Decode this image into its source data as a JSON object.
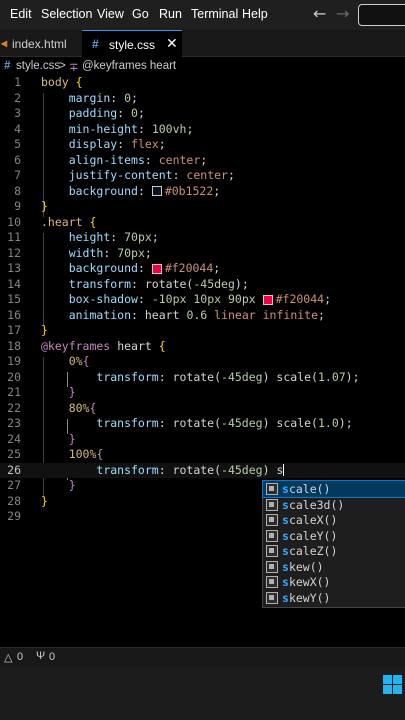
{
  "menubar": {
    "items": [
      "Edit",
      "Selection",
      "View",
      "Go",
      "Run",
      "Terminal",
      "Help"
    ],
    "back_glyph": "←",
    "forward_glyph": "→"
  },
  "tabs": [
    {
      "label": "index.html",
      "icon": "html-file-icon"
    },
    {
      "label": "style.css",
      "icon": "css-file-icon",
      "icon_glyph": "#",
      "close": "✕"
    }
  ],
  "breadcrumb": {
    "file": "style.css",
    "separator": ">",
    "symbol": "@keyframes heart",
    "file_glyph": "#"
  },
  "code_lines": [
    "body {",
    "    margin: 0;",
    "    padding: 0;",
    "    min-height: 100vh;",
    "    display: flex;",
    "    align-items: center;",
    "    justify-content: center;",
    "    background: #0b1522;",
    "}",
    ".heart {",
    "    height: 70px;",
    "    width: 70px;",
    "    background: #f20044;",
    "    transform: rotate(-45deg);",
    "    box-shadow: -10px 10px 90px #f20044;",
    "    animation: heart 0.6 linear infinite;",
    "}",
    "@keyframes heart {",
    "    0%{",
    "        transform: rotate(-45deg) scale(1.07);",
    "    }",
    "    80%{",
    "        transform: rotate(-45deg) scale(1.0);",
    "    }",
    "    100%{",
    "        transform: rotate(-45deg) s",
    "    }",
    "}",
    ""
  ],
  "colors": {
    "bg_swatch": "#0b1522",
    "heart_swatch": "#f20044",
    "accent": "#0078d4"
  },
  "suggestions": {
    "items": [
      "scale()",
      "scale3d()",
      "scaleX()",
      "scaleY()",
      "scaleZ()",
      "skew()",
      "skewX()",
      "skewY()"
    ],
    "typed": "s",
    "icon": "property-icon"
  },
  "status": {
    "errors": "0",
    "ports": "0",
    "error_icon": "warning-icon",
    "port_icon": "antenna-icon"
  }
}
